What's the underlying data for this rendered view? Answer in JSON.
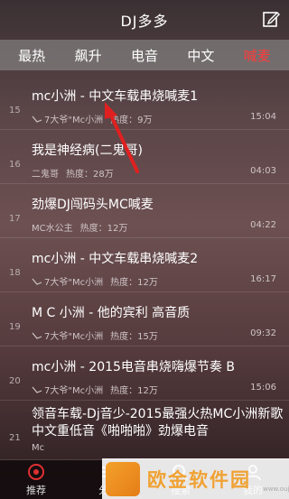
{
  "header": {
    "title": "DJ多多"
  },
  "tabs": [
    {
      "label": "最热"
    },
    {
      "label": "飙升"
    },
    {
      "label": "电音"
    },
    {
      "label": "中文"
    },
    {
      "label": "喊麦"
    }
  ],
  "songs": [
    {
      "rank": "15",
      "title": "mc小洲 - 中文车载串烧喊麦1",
      "uploader": "7大爷\"Mc小洲",
      "heat": "热度：9万",
      "duration": "15:04"
    },
    {
      "rank": "16",
      "title": "我是神经病(二鬼哥)",
      "uploader": "二鬼哥",
      "heat": "热度：28万",
      "duration": "04:03"
    },
    {
      "rank": "17",
      "title": "劲爆DJ闯码头MC喊麦",
      "uploader": "MC水公主",
      "heat": "热度：12万",
      "duration": "04:22"
    },
    {
      "rank": "18",
      "title": "mc小洲 - 中文车载串烧喊麦2",
      "uploader": "7大爷\"Mc小洲",
      "heat": "热度：12万",
      "duration": "16:17"
    },
    {
      "rank": "19",
      "title": "M C 小洲 - 他的宾利 高音质",
      "uploader": "7大爷\"Mc小洲",
      "heat": "热度：15万",
      "duration": "09:32"
    },
    {
      "rank": "20",
      "title": "mc小洲 - 2015电音串烧嗨爆节奏 B",
      "uploader": "7大爷\"Mc小洲",
      "heat": "热度：12万",
      "duration": "15:06"
    },
    {
      "rank": "21",
      "title": "领音车载-Dj音少-2015最强火热MC小洲新歌中文重低音《啪啪啪》劲爆电音",
      "uploader": "Mc",
      "heat": "",
      "duration": ""
    }
  ],
  "bottom_nav": [
    {
      "label": "推荐",
      "icon": "recommend-icon"
    },
    {
      "label": "分类",
      "icon": "menu-icon"
    },
    {
      "label": "搜索",
      "icon": "search-icon"
    },
    {
      "label": "我的",
      "icon": "user-icon"
    }
  ],
  "watermark": {
    "text": "欧金软件园",
    "url": "www.oujin..."
  },
  "colors": {
    "active_tab": "#ff3b3b",
    "arrow": "#e02020",
    "watermark": "#f0a233"
  }
}
